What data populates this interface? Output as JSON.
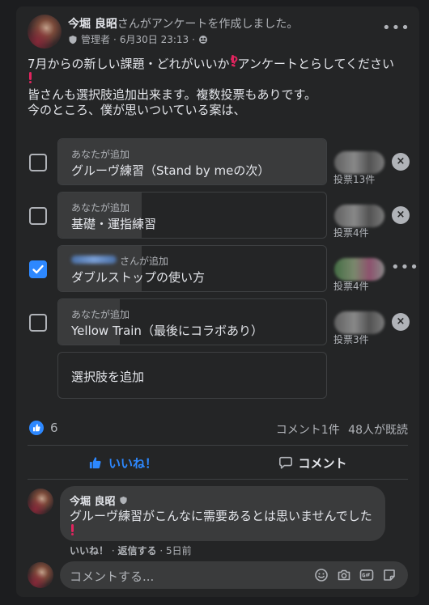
{
  "post": {
    "author": "今堀 良昭",
    "action_text": "さんがアンケートを作成しました。",
    "role": "管理者",
    "date": "6月30日 23:13",
    "more_label": "•••",
    "text_line1": "7月からの新しい課題・どれがいいか",
    "text_line1_after": "アンケートとらしてください",
    "text_line3": "皆さんも選択肢追加出来ます。複数投票もありです。",
    "text_line4": "今のところ、僕が思いついている案は、"
  },
  "poll": {
    "options": [
      {
        "adder": "あなたが追加",
        "label": "グルーヴ練習（Stand by meの次）",
        "votes": "投票13件",
        "checked": false,
        "fill": 1.0
      },
      {
        "adder": "あなたが追加",
        "label": "基礎・運指練習",
        "votes": "投票4件",
        "checked": false,
        "fill": 0.31
      },
      {
        "adder": "さんが追加",
        "label": "ダブルストップの使い方",
        "votes": "投票4件",
        "checked": true,
        "fill": 0.31
      },
      {
        "adder": "あなたが追加",
        "label": "Yellow Train（最後にコラボあり）",
        "votes": "投票3件",
        "checked": false,
        "fill": 0.23
      }
    ],
    "add_option": "選択肢を追加",
    "remove_label": "×",
    "check_mark": "✓"
  },
  "stats": {
    "like_count": "6",
    "comments": "コメント1件",
    "seen": "48人が既読"
  },
  "actions": {
    "like": "いいね！",
    "comment": "コメント"
  },
  "comment": {
    "author": "今堀 良昭",
    "text": "グルーヴ練習がこんなに需要あるとは思いませんでした",
    "like": "いいね！",
    "reply": "返信する",
    "age": "5日前",
    "sep": "·"
  },
  "composer": {
    "placeholder": "コメントする..."
  },
  "colors": {
    "accent": "#2d88ff",
    "background": "#242526",
    "bar_fill": "#3a3b3c"
  }
}
